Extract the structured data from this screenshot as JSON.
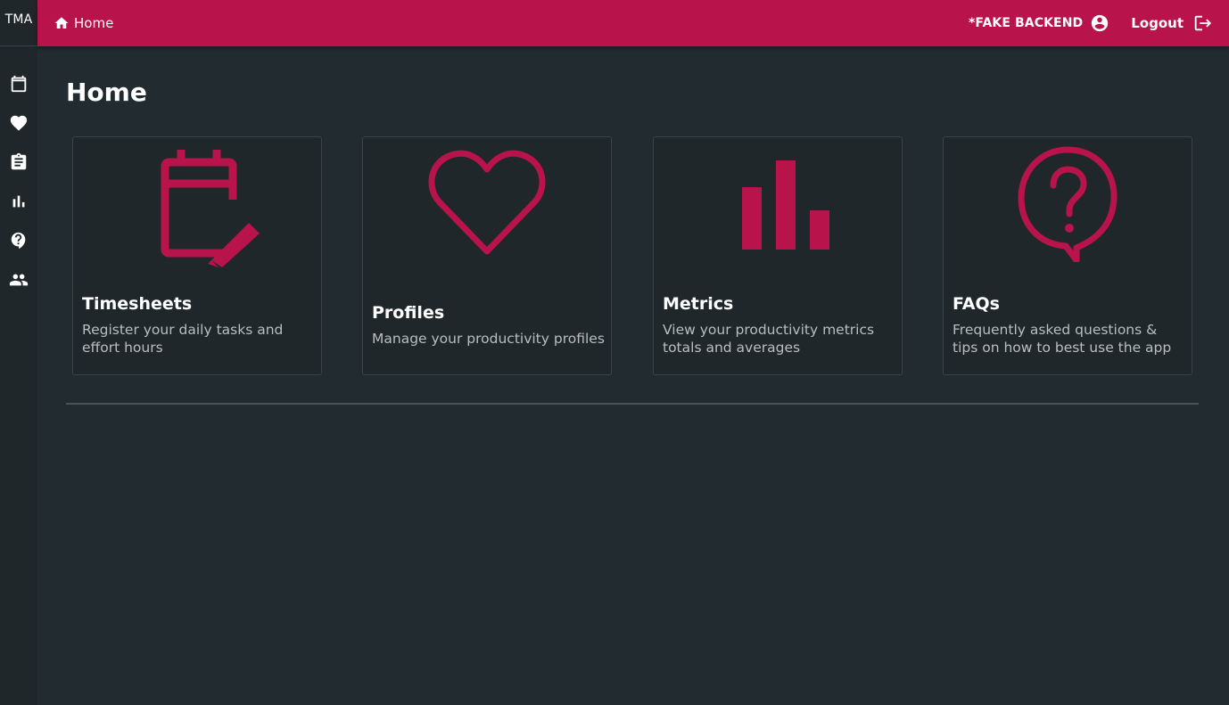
{
  "rail": {
    "brand": "TMA",
    "icons": [
      "calendar-icon",
      "heart-icon",
      "clipboard-icon",
      "bar-chart-icon",
      "help-icon",
      "people-icon"
    ]
  },
  "topbar": {
    "breadcrumb": "Home",
    "backend_label": "*FAKE BACKEND",
    "logout_label": "Logout"
  },
  "page": {
    "title": "Home"
  },
  "cards": [
    {
      "title": "Timesheets",
      "description": "Register your daily tasks and effort hours",
      "icon": "calendar-edit-icon"
    },
    {
      "title": "Profiles",
      "description": "Manage your productivity profiles",
      "icon": "heart-outline-icon"
    },
    {
      "title": "Metrics",
      "description": "View your productivity metrics totals and averages",
      "icon": "bar-chart-icon"
    },
    {
      "title": "FAQs",
      "description": "Frequently asked questions & tips on how to best use the app",
      "icon": "question-bubble-icon"
    }
  ],
  "colors": {
    "accent": "#b8134a",
    "background": "#222b30",
    "card": "#1f272b"
  }
}
